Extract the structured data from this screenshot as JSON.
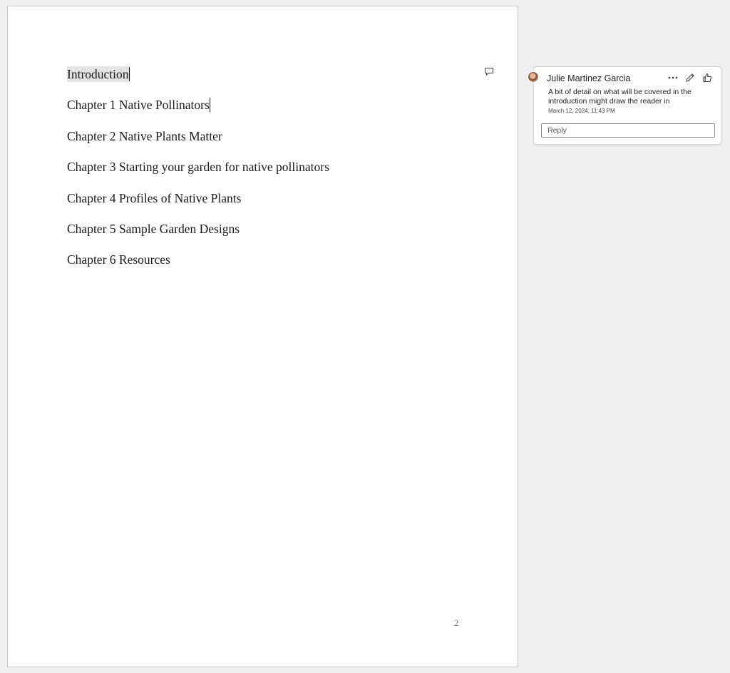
{
  "document": {
    "lines": [
      "Introduction",
      "Chapter 1 Native Pollinators",
      "Chapter 2 Native Plants Matter",
      "Chapter 3 Starting your garden for native pollinators",
      "Chapter 4 Profiles of Native Plants",
      "Chapter 5 Sample Garden Designs",
      "Chapter 6 Resources"
    ],
    "page_number": "2"
  },
  "comment": {
    "author": "Julie Martinez Garcia",
    "text": "A bit of detail on what will be covered in the introduction might draw the reader in",
    "date": "March 12, 2024, 11:43 PM",
    "reply_placeholder": "Reply",
    "icons": {
      "more": "more-options-icon",
      "edit": "edit-pencil-icon",
      "like": "like-thumb-icon",
      "anchor": "comment-anchor-icon"
    }
  },
  "colors": {
    "app_background": "#efefef",
    "page_background": "#ffffff",
    "highlight": "#e3e3e3"
  }
}
